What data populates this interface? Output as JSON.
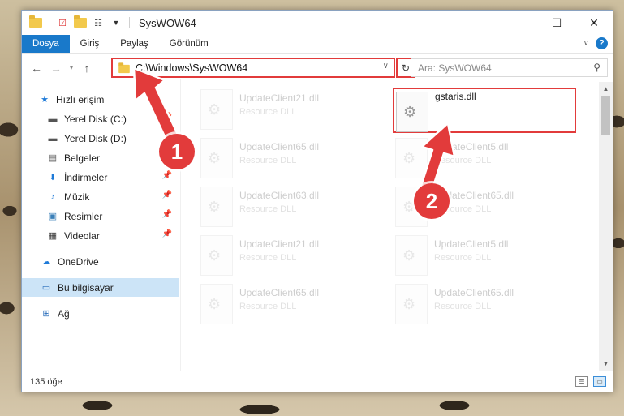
{
  "window": {
    "title": "SysWOW64",
    "minimize_glyph": "—",
    "maximize_glyph": "☐",
    "close_glyph": "✕"
  },
  "ribbon": {
    "tabs": [
      {
        "label": "Dosya",
        "active": true
      },
      {
        "label": "Giriş",
        "active": false
      },
      {
        "label": "Paylaş",
        "active": false
      },
      {
        "label": "Görünüm",
        "active": false
      }
    ],
    "help_label": "?"
  },
  "address": {
    "path": "C:\\Windows\\SysWOW64",
    "search_placeholder": "Ara: SysWOW64"
  },
  "sidebar": {
    "items": [
      {
        "label": "Hızlı erişim",
        "icon": "star-icon",
        "pinned": false
      },
      {
        "label": "Yerel Disk (C:)",
        "icon": "drive-icon",
        "pinned": true
      },
      {
        "label": "Yerel Disk (D:)",
        "icon": "drive-icon",
        "pinned": false
      },
      {
        "label": "Belgeler",
        "icon": "document-icon",
        "pinned": true
      },
      {
        "label": "İndirmeler",
        "icon": "download-icon",
        "pinned": true
      },
      {
        "label": "Müzik",
        "icon": "music-icon",
        "pinned": true
      },
      {
        "label": "Resimler",
        "icon": "picture-icon",
        "pinned": true
      },
      {
        "label": "Videolar",
        "icon": "video-icon",
        "pinned": true
      },
      {
        "label": "OneDrive",
        "icon": "cloud-icon",
        "pinned": false
      },
      {
        "label": "Bu bilgisayar",
        "icon": "computer-icon",
        "pinned": false,
        "selected": true
      },
      {
        "label": "Ağ",
        "icon": "network-icon",
        "pinned": false
      }
    ]
  },
  "files": [
    {
      "name": "UpdateClient21.dll",
      "type": "Resource DLL",
      "faded": true
    },
    {
      "name": "gstaris.dll",
      "type": "",
      "faded": false,
      "highlighted": true
    },
    {
      "name": "UpdateClient65.dll",
      "type": "Resource DLL",
      "faded": true
    },
    {
      "name": "UpdateClient5.dll",
      "type": "Resource DLL",
      "faded": true
    },
    {
      "name": "UpdateClient63.dll",
      "type": "Resource DLL",
      "faded": true
    },
    {
      "name": "UpdateClient65.dll",
      "type": "Resource DLL",
      "faded": true
    },
    {
      "name": "UpdateClient21.dll",
      "type": "Resource DLL",
      "faded": true
    },
    {
      "name": "UpdateClient5.dll",
      "type": "Resource DLL",
      "faded": true
    },
    {
      "name": "UpdateClient65.dll",
      "type": "Resource DLL",
      "faded": true
    },
    {
      "name": "UpdateClient65.dll",
      "type": "Resource DLL",
      "faded": true
    }
  ],
  "status": {
    "item_count": "135 öğe"
  },
  "annotations": {
    "step1": "1",
    "step2": "2",
    "color": "#e23b3b"
  }
}
